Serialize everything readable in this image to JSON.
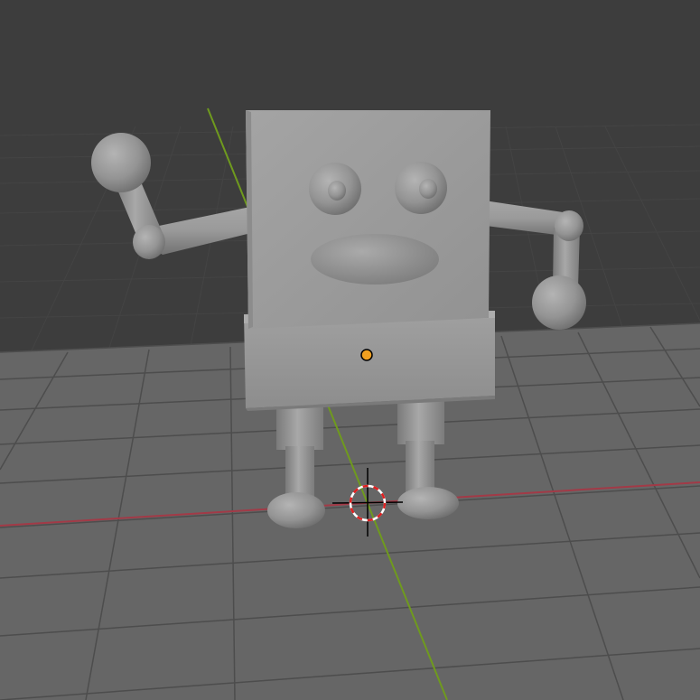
{
  "viewport": {
    "mode": "3d-viewport",
    "shading": "solid"
  },
  "colors": {
    "background": "#3d3d3d",
    "grid_line": "#4a4a4a",
    "x_axis": "#a23a47",
    "y_axis": "#6f9a1e",
    "mesh_base": "#9a9a9a",
    "mesh_dark": "#6c6c6c",
    "origin_point": "#f0a020",
    "cursor_red": "#e02020",
    "cursor_white": "#ffffff"
  },
  "scene_objects": [
    "robot-head",
    "robot-body",
    "robot-eye-left",
    "robot-eye-right",
    "robot-mouth",
    "robot-arm-left",
    "robot-arm-right",
    "robot-leg-left",
    "robot-leg-right"
  ],
  "icons": {
    "origin": "object-origin-icon",
    "cursor": "3d-cursor-icon"
  }
}
